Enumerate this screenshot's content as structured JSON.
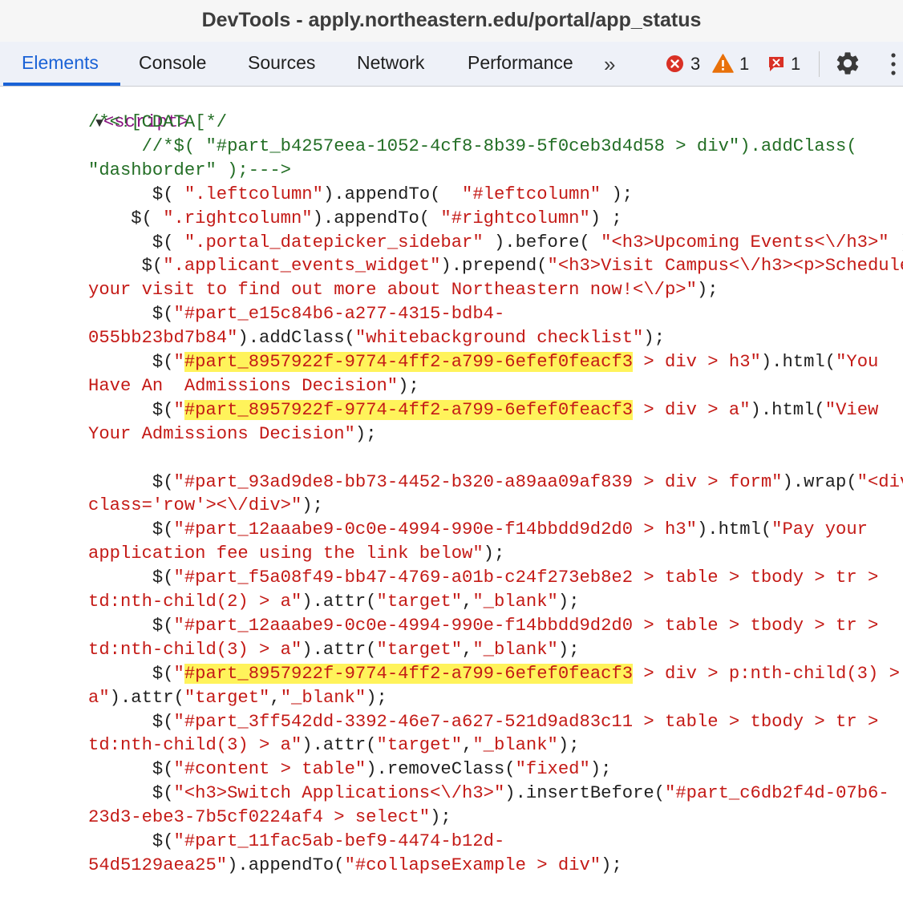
{
  "window": {
    "title": "DevTools - apply.northeastern.edu/portal/app_status"
  },
  "tabs": [
    {
      "label": "Elements",
      "active": true
    },
    {
      "label": "Console"
    },
    {
      "label": "Sources"
    },
    {
      "label": "Network"
    },
    {
      "label": "Performance"
    }
  ],
  "more_tabs_label": "»",
  "status": {
    "errors": "3",
    "warnings": "1",
    "issues": "1"
  },
  "colors": {
    "accent": "#1a62d6",
    "tag": "#881280",
    "comment": "#236e25",
    "string": "#c41a16",
    "highlight": "#fff35b",
    "error": "#d93025",
    "warning": "#e8710a"
  },
  "icons": [
    "more-tabs-icon",
    "error-icon",
    "warning-icon",
    "issues-icon",
    "gear-icon",
    "kebab-menu-icon",
    "expand-triangle-icon"
  ],
  "code": {
    "open_tag": "<script>",
    "lines": [
      [
        {
          "t": "/*<![CDATA[*/",
          "c": "cm"
        }
      ],
      [
        {
          "t": "     //*$( \"#part_b4257eea-1052-4cf8-8b39-5f0ceb3d4d58 > div\").addClass(",
          "c": "cm"
        }
      ],
      [
        {
          "t": "\"dashborder\" );--->",
          "c": "cm"
        }
      ],
      [
        {
          "t": "      $( ",
          "c": "pl"
        },
        {
          "t": "\".leftcolumn\"",
          "c": "str"
        },
        {
          "t": ").appendTo(  ",
          "c": "pl"
        },
        {
          "t": "\"#leftcolumn\"",
          "c": "str"
        },
        {
          "t": " );",
          "c": "pl"
        }
      ],
      [
        {
          "t": "    $( ",
          "c": "pl"
        },
        {
          "t": "\".rightcolumn\"",
          "c": "str"
        },
        {
          "t": ").appendTo( ",
          "c": "pl"
        },
        {
          "t": "\"#rightcolumn\"",
          "c": "str"
        },
        {
          "t": ") ;",
          "c": "pl"
        }
      ],
      [
        {
          "t": "      $( ",
          "c": "pl"
        },
        {
          "t": "\".portal_datepicker_sidebar\"",
          "c": "str"
        },
        {
          "t": " ).before( ",
          "c": "pl"
        },
        {
          "t": "\"<h3>Upcoming Events<\\/h3>\"",
          "c": "str"
        },
        {
          "t": " );",
          "c": "pl"
        }
      ],
      [
        {
          "t": "     $(",
          "c": "pl"
        },
        {
          "t": "\".applicant_events_widget\"",
          "c": "str"
        },
        {
          "t": ").prepend(",
          "c": "pl"
        },
        {
          "t": "\"<h3>Visit Campus<\\/h3><p>Schedule",
          "c": "str"
        }
      ],
      [
        {
          "t": "your visit to find out more about Northeastern now!<\\/p>\"",
          "c": "str"
        },
        {
          "t": ");",
          "c": "pl"
        }
      ],
      [
        {
          "t": "      $(",
          "c": "pl"
        },
        {
          "t": "\"#part_e15c84b6-a277-4315-bdb4-",
          "c": "str"
        }
      ],
      [
        {
          "t": "055bb23bd7b84\"",
          "c": "str"
        },
        {
          "t": ").addClass(",
          "c": "pl"
        },
        {
          "t": "\"whitebackground checklist\"",
          "c": "str"
        },
        {
          "t": ");",
          "c": "pl"
        }
      ],
      [
        {
          "t": "      $(",
          "c": "pl"
        },
        {
          "t": "\"",
          "c": "str"
        },
        {
          "t": "#part_8957922f-9774-4ff2-a799-6efef0feacf3",
          "c": "hl"
        },
        {
          "t": " > div > h3\"",
          "c": "str"
        },
        {
          "t": ").html(",
          "c": "pl"
        },
        {
          "t": "\"You",
          "c": "str"
        }
      ],
      [
        {
          "t": "Have An  Admissions Decision\"",
          "c": "str"
        },
        {
          "t": ");",
          "c": "pl"
        }
      ],
      [
        {
          "t": "      $(",
          "c": "pl"
        },
        {
          "t": "\"",
          "c": "str"
        },
        {
          "t": "#part_8957922f-9774-4ff2-a799-6efef0feacf3",
          "c": "hl"
        },
        {
          "t": " > div > a\"",
          "c": "str"
        },
        {
          "t": ").html(",
          "c": "pl"
        },
        {
          "t": "\"View",
          "c": "str"
        }
      ],
      [
        {
          "t": "Your Admissions Decision\"",
          "c": "str"
        },
        {
          "t": ");",
          "c": "pl"
        }
      ],
      [],
      [
        {
          "t": "      $(",
          "c": "pl"
        },
        {
          "t": "\"#part_93ad9de8-bb73-4452-b320-a89aa09af839 > div > form\"",
          "c": "str"
        },
        {
          "t": ").wrap(",
          "c": "pl"
        },
        {
          "t": "\"<div",
          "c": "str"
        }
      ],
      [
        {
          "t": "class='row'><\\/div>\"",
          "c": "str"
        },
        {
          "t": ");",
          "c": "pl"
        }
      ],
      [
        {
          "t": "      $(",
          "c": "pl"
        },
        {
          "t": "\"#part_12aaabe9-0c0e-4994-990e-f14bbdd9d2d0 > h3\"",
          "c": "str"
        },
        {
          "t": ").html(",
          "c": "pl"
        },
        {
          "t": "\"Pay your",
          "c": "str"
        }
      ],
      [
        {
          "t": "application fee using the link below\"",
          "c": "str"
        },
        {
          "t": ");",
          "c": "pl"
        }
      ],
      [
        {
          "t": "      $(",
          "c": "pl"
        },
        {
          "t": "\"#part_f5a08f49-bb47-4769-a01b-c24f273eb8e2 > table > tbody > tr >",
          "c": "str"
        }
      ],
      [
        {
          "t": "td:nth-child(2) > a\"",
          "c": "str"
        },
        {
          "t": ").attr(",
          "c": "pl"
        },
        {
          "t": "\"target\"",
          "c": "str"
        },
        {
          "t": ",",
          "c": "pl"
        },
        {
          "t": "\"_blank\"",
          "c": "str"
        },
        {
          "t": ");",
          "c": "pl"
        }
      ],
      [
        {
          "t": "      $(",
          "c": "pl"
        },
        {
          "t": "\"#part_12aaabe9-0c0e-4994-990e-f14bbdd9d2d0 > table > tbody > tr >",
          "c": "str"
        }
      ],
      [
        {
          "t": "td:nth-child(3) > a\"",
          "c": "str"
        },
        {
          "t": ").attr(",
          "c": "pl"
        },
        {
          "t": "\"target\"",
          "c": "str"
        },
        {
          "t": ",",
          "c": "pl"
        },
        {
          "t": "\"_blank\"",
          "c": "str"
        },
        {
          "t": ");",
          "c": "pl"
        }
      ],
      [
        {
          "t": "      $(",
          "c": "pl"
        },
        {
          "t": "\"",
          "c": "str"
        },
        {
          "t": "#part_8957922f-9774-4ff2-a799-6efef0feacf3",
          "c": "hl"
        },
        {
          "t": " > div > p:nth-child(3) >",
          "c": "str"
        }
      ],
      [
        {
          "t": "a\"",
          "c": "str"
        },
        {
          "t": ").attr(",
          "c": "pl"
        },
        {
          "t": "\"target\"",
          "c": "str"
        },
        {
          "t": ",",
          "c": "pl"
        },
        {
          "t": "\"_blank\"",
          "c": "str"
        },
        {
          "t": ");",
          "c": "pl"
        }
      ],
      [
        {
          "t": "      $(",
          "c": "pl"
        },
        {
          "t": "\"#part_3ff542dd-3392-46e7-a627-521d9ad83c11 > table > tbody > tr >",
          "c": "str"
        }
      ],
      [
        {
          "t": "td:nth-child(3) > a\"",
          "c": "str"
        },
        {
          "t": ").attr(",
          "c": "pl"
        },
        {
          "t": "\"target\"",
          "c": "str"
        },
        {
          "t": ",",
          "c": "pl"
        },
        {
          "t": "\"_blank\"",
          "c": "str"
        },
        {
          "t": ");",
          "c": "pl"
        }
      ],
      [
        {
          "t": "      $(",
          "c": "pl"
        },
        {
          "t": "\"#content > table\"",
          "c": "str"
        },
        {
          "t": ").removeClass(",
          "c": "pl"
        },
        {
          "t": "\"fixed\"",
          "c": "str"
        },
        {
          "t": ");",
          "c": "pl"
        }
      ],
      [
        {
          "t": "      $(",
          "c": "pl"
        },
        {
          "t": "\"<h3>Switch Applications<\\/h3>\"",
          "c": "str"
        },
        {
          "t": ").insertBefore(",
          "c": "pl"
        },
        {
          "t": "\"#part_c6db2f4d-07b6-",
          "c": "str"
        }
      ],
      [
        {
          "t": "23d3-ebe3-7b5cf0224af4 > select\"",
          "c": "str"
        },
        {
          "t": ");",
          "c": "pl"
        }
      ],
      [
        {
          "t": "      $(",
          "c": "pl"
        },
        {
          "t": "\"#part_11fac5ab-bef9-4474-b12d-",
          "c": "str"
        }
      ],
      [
        {
          "t": "54d5129aea25\"",
          "c": "str"
        },
        {
          "t": ").appendTo(",
          "c": "pl"
        },
        {
          "t": "\"#collapseExample > div\"",
          "c": "str"
        },
        {
          "t": ");",
          "c": "pl"
        }
      ]
    ]
  }
}
